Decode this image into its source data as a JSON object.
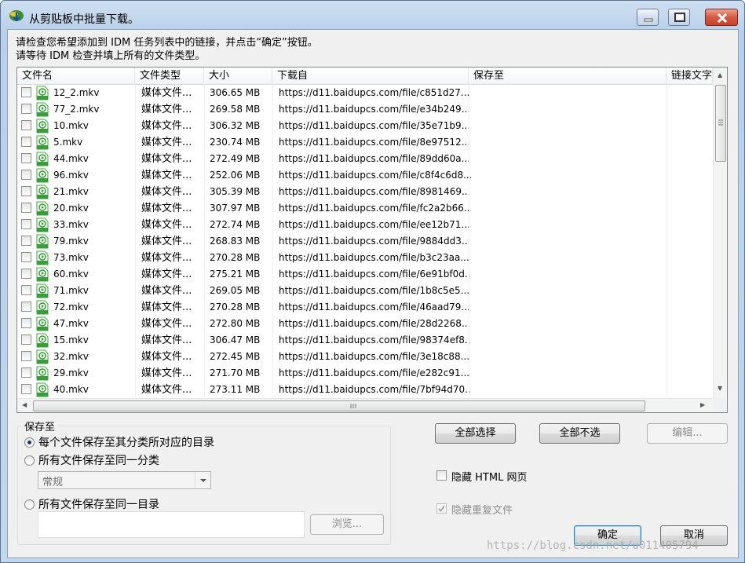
{
  "window": {
    "title": "从剪贴板中批量下载。"
  },
  "instructions": {
    "line1": "请检查您希望添加到 IDM 任务列表中的链接，并点击“确定”按钮。",
    "line2": "请等待 IDM 检查并填上所有的文件类型。"
  },
  "columns": [
    "文件名",
    "文件类型",
    "大小",
    "下载自",
    "保存至",
    "链接文字"
  ],
  "rows": [
    {
      "name": "12_2.mkv",
      "type": "媒体文件...",
      "size": "306.65  MB",
      "url": "https://d11.baidupcs.com/file/c851d27..."
    },
    {
      "name": "77_2.mkv",
      "type": "媒体文件...",
      "size": "269.58  MB",
      "url": "https://d11.baidupcs.com/file/e34b249..."
    },
    {
      "name": "10.mkv",
      "type": "媒体文件...",
      "size": "306.32  MB",
      "url": "https://d11.baidupcs.com/file/35e71b9..."
    },
    {
      "name": "5.mkv",
      "type": "媒体文件...",
      "size": "230.74  MB",
      "url": "https://d11.baidupcs.com/file/8e97512..."
    },
    {
      "name": "44.mkv",
      "type": "媒体文件...",
      "size": "272.49  MB",
      "url": "https://d11.baidupcs.com/file/89dd60a..."
    },
    {
      "name": "96.mkv",
      "type": "媒体文件...",
      "size": "252.06  MB",
      "url": "https://d11.baidupcs.com/file/c8f4c6d8..."
    },
    {
      "name": "21.mkv",
      "type": "媒体文件...",
      "size": "305.39  MB",
      "url": "https://d11.baidupcs.com/file/8981469..."
    },
    {
      "name": "20.mkv",
      "type": "媒体文件...",
      "size": "307.97  MB",
      "url": "https://d11.baidupcs.com/file/fc2a2b66..."
    },
    {
      "name": "33.mkv",
      "type": "媒体文件...",
      "size": "272.74  MB",
      "url": "https://d11.baidupcs.com/file/ee12b71..."
    },
    {
      "name": "79.mkv",
      "type": "媒体文件...",
      "size": "268.83  MB",
      "url": "https://d11.baidupcs.com/file/9884dd3..."
    },
    {
      "name": "73.mkv",
      "type": "媒体文件...",
      "size": "270.28  MB",
      "url": "https://d11.baidupcs.com/file/b3c23aa..."
    },
    {
      "name": "60.mkv",
      "type": "媒体文件...",
      "size": "275.21  MB",
      "url": "https://d11.baidupcs.com/file/6e91bf0d..."
    },
    {
      "name": "71.mkv",
      "type": "媒体文件...",
      "size": "269.05  MB",
      "url": "https://d11.baidupcs.com/file/1b8c5e5..."
    },
    {
      "name": "72.mkv",
      "type": "媒体文件...",
      "size": "270.28  MB",
      "url": "https://d11.baidupcs.com/file/46aad79..."
    },
    {
      "name": "47.mkv",
      "type": "媒体文件...",
      "size": "272.80  MB",
      "url": "https://d11.baidupcs.com/file/28d2268..."
    },
    {
      "name": "15.mkv",
      "type": "媒体文件...",
      "size": "306.47  MB",
      "url": "https://d11.baidupcs.com/file/98374ef8..."
    },
    {
      "name": "32.mkv",
      "type": "媒体文件...",
      "size": "272.45  MB",
      "url": "https://d11.baidupcs.com/file/3e18c88..."
    },
    {
      "name": "29.mkv",
      "type": "媒体文件...",
      "size": "271.70  MB",
      "url": "https://d11.baidupcs.com/file/e282c91..."
    },
    {
      "name": "40.mkv",
      "type": "媒体文件...",
      "size": "273.11  MB",
      "url": "https://d11.baidupcs.com/file/7bf94d70..."
    }
  ],
  "save": {
    "group_title": "保存至",
    "opt_category_dir": "每个文件保存至其分类所对应的目录",
    "opt_same_category": "所有文件保存至同一分类",
    "category_value": "常规",
    "opt_same_dir": "所有文件保存至同一目录",
    "browse": "浏览..."
  },
  "buttons": {
    "select_all": "全部选择",
    "deselect_all": "全部不选",
    "edit": "编辑...",
    "ok": "确定",
    "cancel": "取消"
  },
  "options": {
    "hide_html": "隐藏 HTML 网页",
    "hide_duplicates": "隐藏重复文件"
  },
  "watermark": "https://blog.csdn.net/u011405794"
}
